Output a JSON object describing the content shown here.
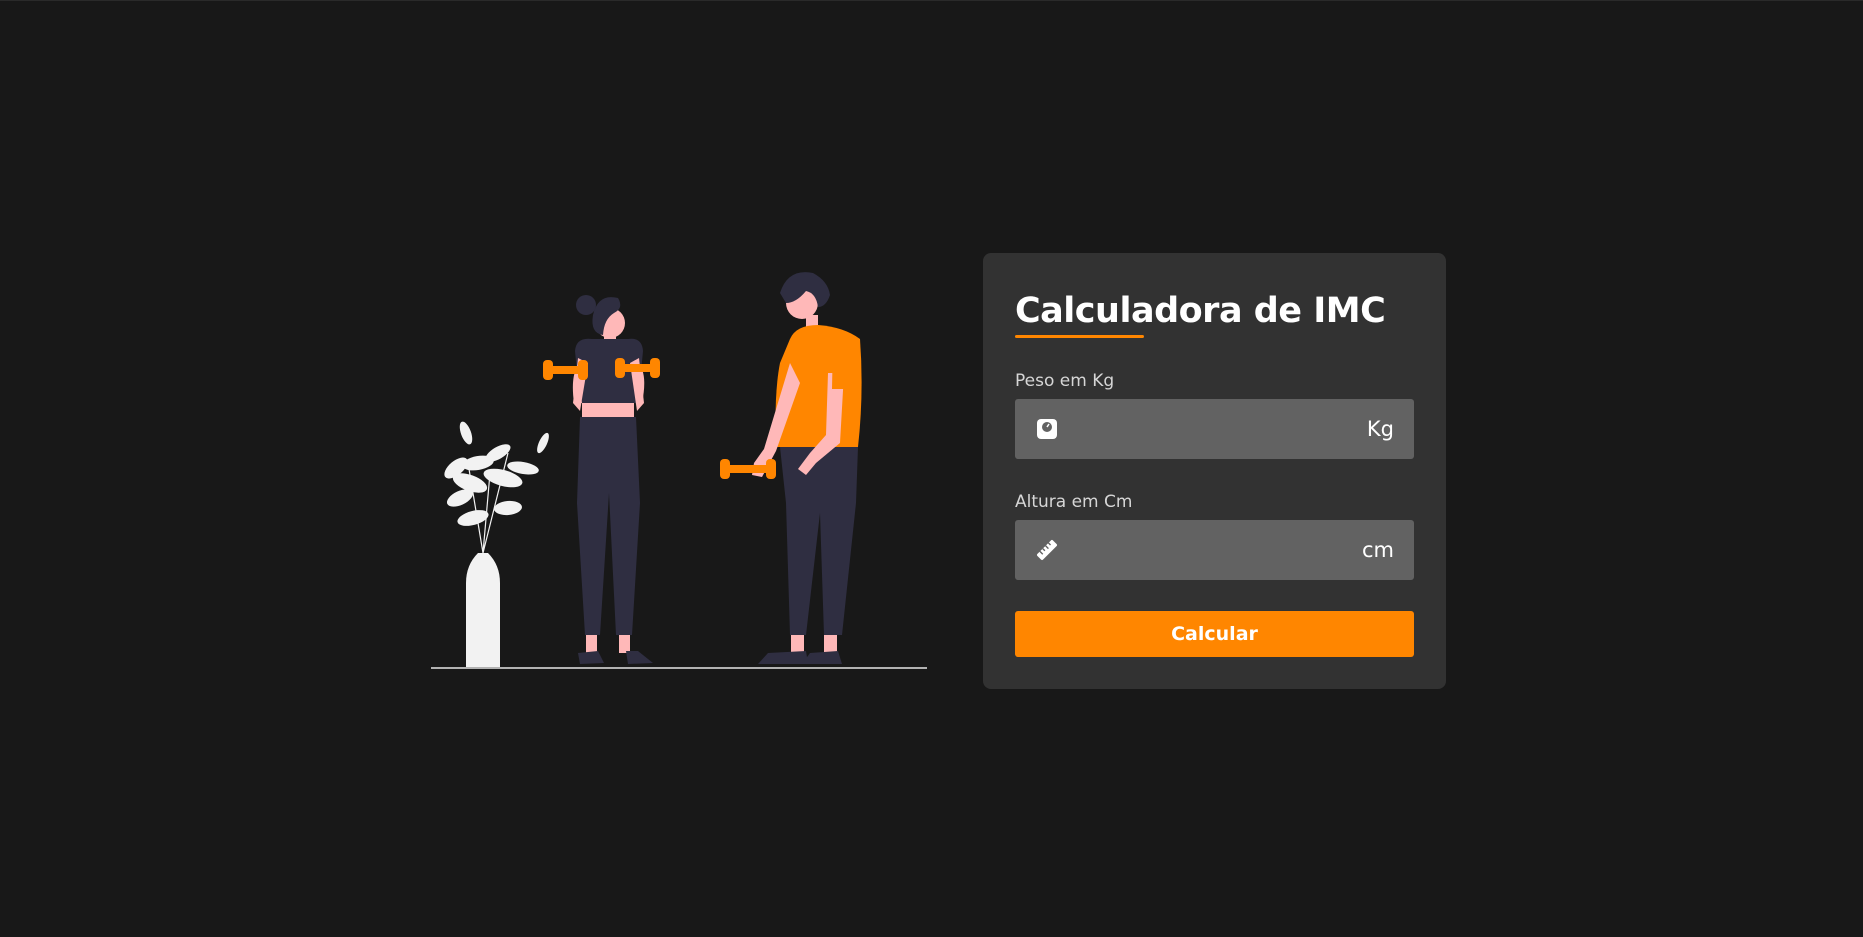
{
  "card": {
    "title": "Calculadora de IMC",
    "weight": {
      "label": "Peso em Kg",
      "value": "",
      "unit": "Kg",
      "icon": "weight-scale-icon"
    },
    "height": {
      "label": "Altura em Cm",
      "value": "",
      "unit": "cm",
      "icon": "ruler-icon"
    },
    "button_label": "Calcular"
  },
  "colors": {
    "background": "#181818",
    "card": "#323232",
    "input": "#626262",
    "accent": "#ff8600",
    "figure_dark": "#2f2e41",
    "skin": "#ffb8b8",
    "plant": "#f2f2f2"
  }
}
